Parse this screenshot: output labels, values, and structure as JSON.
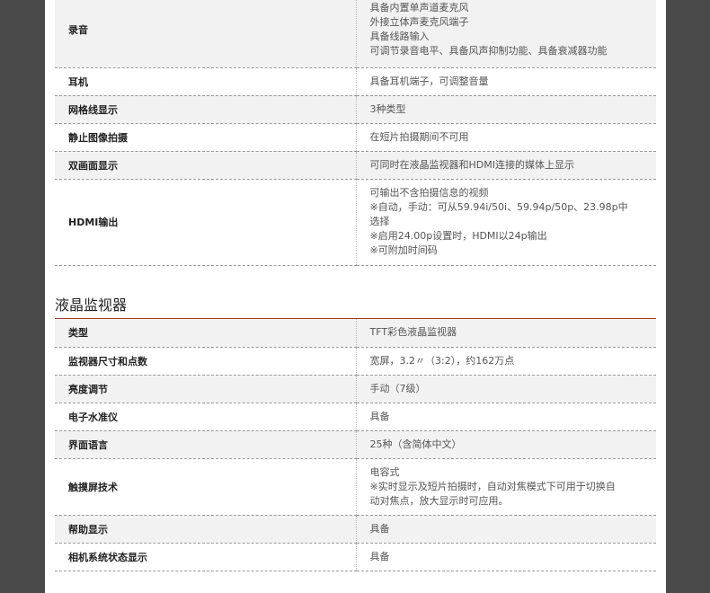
{
  "table1": [
    {
      "label": "录音",
      "lines": [
        "具备内置单声道麦克风",
        "外接立体声麦克风端子",
        "具备线路输入",
        "可调节录音电平、具备风声抑制功能、具备衰减器功能"
      ]
    },
    {
      "label": "耳机",
      "lines": [
        "具备耳机端子，可调整音量"
      ]
    },
    {
      "label": "网格线显示",
      "lines": [
        "3种类型"
      ]
    },
    {
      "label": "静止图像拍摄",
      "lines": [
        "在短片拍摄期间不可用"
      ]
    },
    {
      "label": "双画面显示",
      "lines": [
        "可同时在液晶监视器和HDMI连接的媒体上显示"
      ]
    },
    {
      "label": "HDMI输出",
      "lines": [
        "可输出不含拍摄信息的视频",
        "※自动，手动：可从59.94i/50i、59.94p/50p、23.98p中",
        "选择",
        "※启用24.00p设置时，HDMI以24p输出",
        "※可附加时间码"
      ]
    }
  ],
  "section2_title": "液晶监视器",
  "table2": [
    {
      "label": "类型",
      "lines": [
        "TFT彩色液晶监视器"
      ]
    },
    {
      "label": "监视器尺寸和点数",
      "lines": [
        "宽屏，3.2〃（3:2），约162万点"
      ]
    },
    {
      "label": "亮度调节",
      "lines": [
        "手动（7级）"
      ]
    },
    {
      "label": "电子水准仪",
      "lines": [
        "具备"
      ]
    },
    {
      "label": "界面语言",
      "lines": [
        "25种（含简体中文）"
      ]
    },
    {
      "label": "触摸屏技术",
      "lines": [
        "电容式",
        "※实时显示及短片拍摄时，自动对焦模式下可用于切换自",
        "动对焦点，放大显示时可应用。"
      ]
    },
    {
      "label": "帮助显示",
      "lines": [
        "具备"
      ]
    },
    {
      "label": "相机系统状态显示",
      "lines": [
        "具备"
      ]
    }
  ]
}
